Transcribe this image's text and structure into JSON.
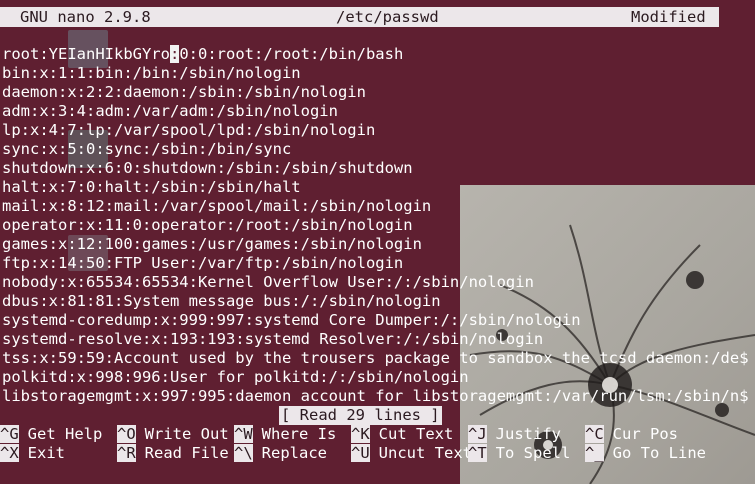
{
  "titlebar": {
    "app": "GNU nano 2.9.8",
    "file": "/etc/passwd",
    "status": "Modified"
  },
  "buffer": {
    "cursor_line": 0,
    "cursor_col": 18,
    "lines": [
      "root:YEIanHIkbGYro:0:0:root:/root:/bin/bash",
      "bin:x:1:1:bin:/bin:/sbin/nologin",
      "daemon:x:2:2:daemon:/sbin:/sbin/nologin",
      "adm:x:3:4:adm:/var/adm:/sbin/nologin",
      "lp:x:4:7:lp:/var/spool/lpd:/sbin/nologin",
      "sync:x:5:0:sync:/sbin:/bin/sync",
      "shutdown:x:6:0:shutdown:/sbin:/sbin/shutdown",
      "halt:x:7:0:halt:/sbin:/sbin/halt",
      "mail:x:8:12:mail:/var/spool/mail:/sbin/nologin",
      "operator:x:11:0:operator:/root:/sbin/nologin",
      "games:x:12:100:games:/usr/games:/sbin/nologin",
      "ftp:x:14:50:FTP User:/var/ftp:/sbin/nologin",
      "nobody:x:65534:65534:Kernel Overflow User:/:/sbin/nologin",
      "dbus:x:81:81:System message bus:/:/sbin/nologin",
      "systemd-coredump:x:999:997:systemd Core Dumper:/:/sbin/nologin",
      "systemd-resolve:x:193:193:systemd Resolver:/:/sbin/nologin",
      "tss:x:59:59:Account used by the trousers package to sandbox the tcsd daemon:/de$",
      "polkitd:x:998:996:User for polkitd:/:/sbin/nologin",
      "libstoragemgmt:x:997:995:daemon account for libstoragemgmt:/var/run/lsm:/sbin/n$"
    ]
  },
  "status_message": "[ Read 29 lines ]",
  "shortcuts": {
    "row1": [
      {
        "key": "^G",
        "label": "Get Help"
      },
      {
        "key": "^O",
        "label": "Write Out"
      },
      {
        "key": "^W",
        "label": "Where Is"
      },
      {
        "key": "^K",
        "label": "Cut Text"
      },
      {
        "key": "^J",
        "label": "Justify"
      },
      {
        "key": "^C",
        "label": "Cur Pos"
      }
    ],
    "row2": [
      {
        "key": "^X",
        "label": "Exit"
      },
      {
        "key": "^R",
        "label": "Read File"
      },
      {
        "key": "^\\",
        "label": "Replace"
      },
      {
        "key": "^U",
        "label": "Uncut Text"
      },
      {
        "key": "^T",
        "label": "To Spell"
      },
      {
        "key": "^_",
        "label": "Go To Line"
      }
    ]
  },
  "colors": {
    "background": "#5f1f31",
    "bar": "#ece7ea",
    "text": "#ffffff"
  }
}
